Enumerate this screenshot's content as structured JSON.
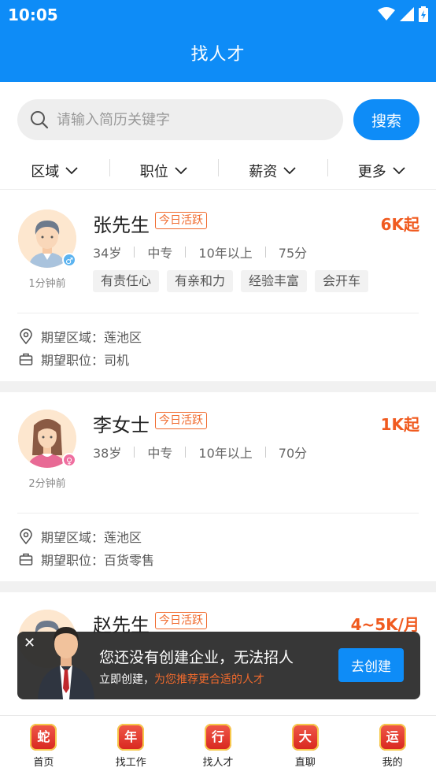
{
  "status_bar": {
    "time": "10:05"
  },
  "nav": {
    "title": "找人才"
  },
  "search": {
    "placeholder": "请输入简历关键字",
    "button_label": "搜索"
  },
  "filters": [
    {
      "label": "区域"
    },
    {
      "label": "职位"
    },
    {
      "label": "薪资"
    },
    {
      "label": "更多"
    }
  ],
  "candidates": [
    {
      "name": "张先生",
      "active_tag": "今日活跃",
      "salary": "6K起",
      "time_ago": "1分钟前",
      "gender": "male",
      "age": "34岁",
      "education": "中专",
      "experience": "10年以上",
      "score": "75分",
      "tags": [
        "有责任心",
        "有亲和力",
        "经验丰富",
        "会开车"
      ],
      "expect_area": "期望区域：莲池区",
      "expect_position": "期望职位：司机"
    },
    {
      "name": "李女士",
      "active_tag": "今日活跃",
      "salary": "1K起",
      "time_ago": "2分钟前",
      "gender": "female",
      "age": "38岁",
      "education": "中专",
      "experience": "10年以上",
      "score": "70分",
      "tags": [],
      "expect_area": "期望区域：莲池区",
      "expect_position": "期望职位：百货零售"
    },
    {
      "name": "赵先生",
      "active_tag": "今日活跃",
      "salary": "4~5K/月"
    }
  ],
  "banner": {
    "message": "您还没有创建企业，无法招人",
    "sub_prefix": "立即创建，",
    "sub_highlight": "为您推荐更合适的人才",
    "button_label": "去创建",
    "close_icon": "close-icon"
  },
  "tabs": [
    {
      "label": "首页",
      "glyph": "蛇"
    },
    {
      "label": "找工作",
      "glyph": "年"
    },
    {
      "label": "找人才",
      "glyph": "行"
    },
    {
      "label": "直聊",
      "glyph": "大"
    },
    {
      "label": "我的",
      "glyph": "运"
    }
  ],
  "colors": {
    "primary": "#0e8cf7",
    "accent": "#f05a1f"
  }
}
